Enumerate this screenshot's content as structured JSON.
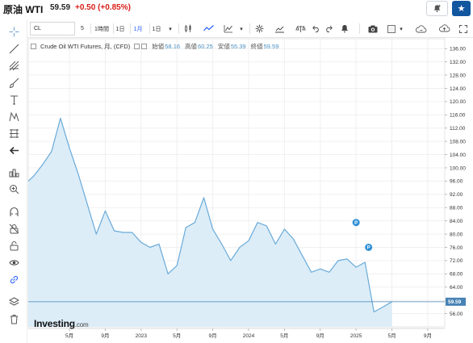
{
  "header": {
    "title": "原油 WTI",
    "price": "59.59",
    "change": "+0.50 (+0.85%)"
  },
  "toolbar": {
    "symbol": "CL",
    "intervals": [
      "5",
      "1時間",
      "1日",
      "1月",
      "1日"
    ],
    "active_interval_index": 3
  },
  "legend": {
    "series_name": "Crude Oil WTI Futures, 月, (CFD)",
    "open_label": "始値",
    "open": "58.16",
    "high_label": "高値",
    "high": "60.25",
    "low_label": "安値",
    "low": "55.39",
    "close_label": "終値",
    "close": "59.59"
  },
  "logo": {
    "brand": "Investing",
    "suffix": ".com"
  },
  "colors": {
    "line": "#6aaad8",
    "area": "#dcedf8",
    "price_tag": "#4682b4",
    "accent": "#2962ff",
    "negative": "#d91e18"
  },
  "chart_data": {
    "type": "area",
    "x": [
      "2022-01",
      "2022-02",
      "2022-03",
      "2022-04",
      "2022-05",
      "2022-06",
      "2022-07",
      "2022-08",
      "2022-09",
      "2022-10",
      "2022-11",
      "2022-12",
      "2023-01",
      "2023-02",
      "2023-03",
      "2023-04",
      "2023-05",
      "2023-06",
      "2023-07",
      "2023-08",
      "2023-09",
      "2023-10",
      "2023-11",
      "2023-12",
      "2024-01",
      "2024-02",
      "2024-03",
      "2024-04",
      "2024-05",
      "2024-06",
      "2024-07",
      "2024-08",
      "2024-09",
      "2024-10",
      "2024-11",
      "2024-12",
      "2025-01",
      "2025-02",
      "2025-03",
      "2025-04",
      "2025-05"
    ],
    "series": [
      {
        "values": [
          97.5,
          101,
          105,
          115,
          106,
          98,
          89,
          80,
          87,
          81,
          80.5,
          80.5,
          77.5,
          76,
          77,
          68,
          70.5,
          82,
          83.5,
          91,
          81.5,
          77,
          72,
          76,
          78,
          83.5,
          82.5,
          77,
          81.5,
          78.5,
          73.5,
          68.5,
          69.5,
          68.5,
          72,
          72.5,
          70,
          71.5,
          56.5,
          58,
          59.59
        ]
      }
    ],
    "y_ticks": [
      56,
      60,
      64,
      68,
      72,
      76,
      80,
      84,
      88,
      92,
      96,
      100,
      104,
      108,
      112,
      116,
      120,
      124,
      128,
      132,
      136
    ],
    "ylim": [
      52,
      138
    ],
    "x_ticks": [
      "5月",
      "9月",
      "2023",
      "5月",
      "9月",
      "2024",
      "5月",
      "9月",
      "2025",
      "5月",
      "9月"
    ],
    "last_price_label": "59.59",
    "event_markers": [
      "P",
      "P"
    ],
    "grid": true
  }
}
